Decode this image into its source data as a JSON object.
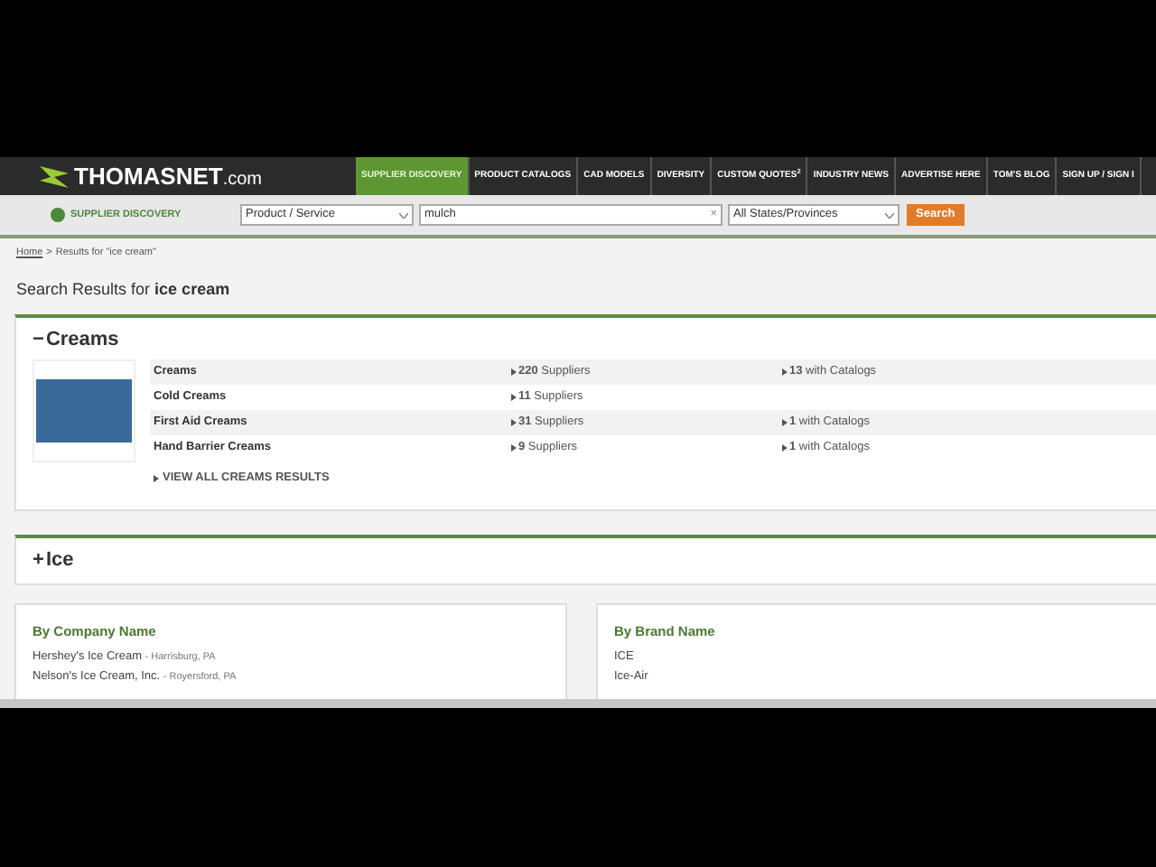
{
  "logo": {
    "text": "THOMASNET",
    "suffix": ".com"
  },
  "nav": [
    {
      "label": "SUPPLIER DISCOVERY",
      "selected": true
    },
    {
      "label": "PRODUCT CATALOGS",
      "selected": false
    },
    {
      "label": "CAD MODELS",
      "selected": false
    },
    {
      "label": "DIVERSITY",
      "selected": false
    },
    {
      "label": "CUSTOM QUOTES$^{2}$",
      "selected": false
    },
    {
      "label": "INDUSTRY NEWS",
      "selected": false
    },
    {
      "label": "ADVERTISE HERE",
      "selected": false
    },
    {
      "label": "TOM'S BLOG",
      "selected": false
    },
    {
      "label": "SIGN UP / SIGN I",
      "selected": false
    }
  ],
  "search_bar": {
    "section": "SUPPLIER DISCOVERY",
    "type_select": "Product / Service",
    "query": "mulch",
    "clear": "×",
    "region_select": "All States/Provinces",
    "button": "Search"
  },
  "breadcrumb": {
    "home": "Home",
    "separator": ">",
    "current": "Results for \"ice cream\""
  },
  "heading": {
    "prefix": "Search Results for",
    "query": "ice cream"
  },
  "categories": [
    {
      "toggle": "−",
      "title": "Creams",
      "expanded": true,
      "rows": [
        {
          "name": "Creams",
          "suppliers": "**220** Suppliers",
          "catalogs": "**13** with Catalogs"
        },
        {
          "name": "Cold Creams",
          "suppliers": "**11** Suppliers"
        },
        {
          "name": "First Aid Creams",
          "suppliers": "**31** Suppliers",
          "catalogs": "**1** with Catalogs"
        },
        {
          "name": "Hand Barrier Creams",
          "suppliers": "**9** Suppliers",
          "catalogs": "**1** with Catalogs"
        }
      ],
      "view_all": "VIEW ALL CREAMS RESULTS"
    },
    {
      "toggle": "+",
      "title": "Ice",
      "expanded": false
    }
  ],
  "company_box": {
    "title": "By Company Name",
    "items": [
      {
        "name": "Hershey's Ice Cream",
        "location": "- Harrisburg, PA"
      },
      {
        "name": "Nelson's Ice Cream, Inc.",
        "location": "- Royersford, PA"
      }
    ]
  },
  "brand_box": {
    "title": "By Brand Name",
    "items": [
      "ICE",
      "Ice-Air"
    ]
  }
}
